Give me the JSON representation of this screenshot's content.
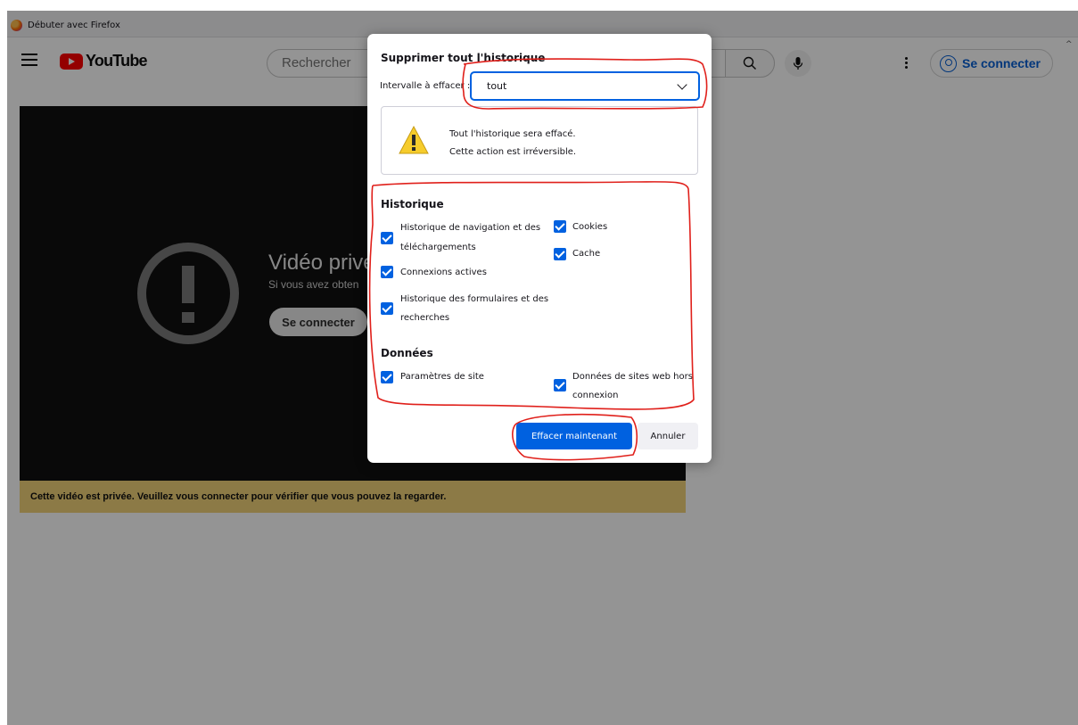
{
  "browser": {
    "bookmark_label": "Débuter avec Firefox"
  },
  "youtube": {
    "logo_text": "YouTube",
    "search_placeholder": "Rechercher",
    "signin_label": "Se connecter",
    "player": {
      "title": "Vidéo privé",
      "subtitle": "Si vous avez obten",
      "signin_label": "Se connecter"
    },
    "banner_text": "Cette vidéo est privée. Veuillez vous connecter pour vérifier que vous pouvez la regarder."
  },
  "dialog": {
    "title": "Supprimer tout l'historique",
    "range_label": "Intervalle à effacer :",
    "range_value": "tout",
    "warning_line1": "Tout l'historique sera effacé.",
    "warning_line2": "Cette action est irréversible.",
    "history_heading": "Historique",
    "history_items": [
      {
        "line1": "Historique de navigation et des",
        "line2": "téléchargements",
        "checked": true
      },
      {
        "line1": "Connexions actives",
        "checked": true
      },
      {
        "line1": "Historique des formulaires et des",
        "line2": "recherches",
        "checked": true
      },
      {
        "line1": "Cookies",
        "checked": true
      },
      {
        "line1": "Cache",
        "checked": true
      }
    ],
    "data_heading": "Données",
    "data_items": [
      {
        "line1": "Paramètres de site",
        "checked": true
      },
      {
        "line1": "Données de sites web hors",
        "line2": "connexion",
        "checked": true
      }
    ],
    "clear_button": "Effacer maintenant",
    "cancel_button": "Annuler"
  },
  "colors": {
    "accent": "#0061e0",
    "annotation": "#e0201b",
    "banner": "#f2d379"
  }
}
